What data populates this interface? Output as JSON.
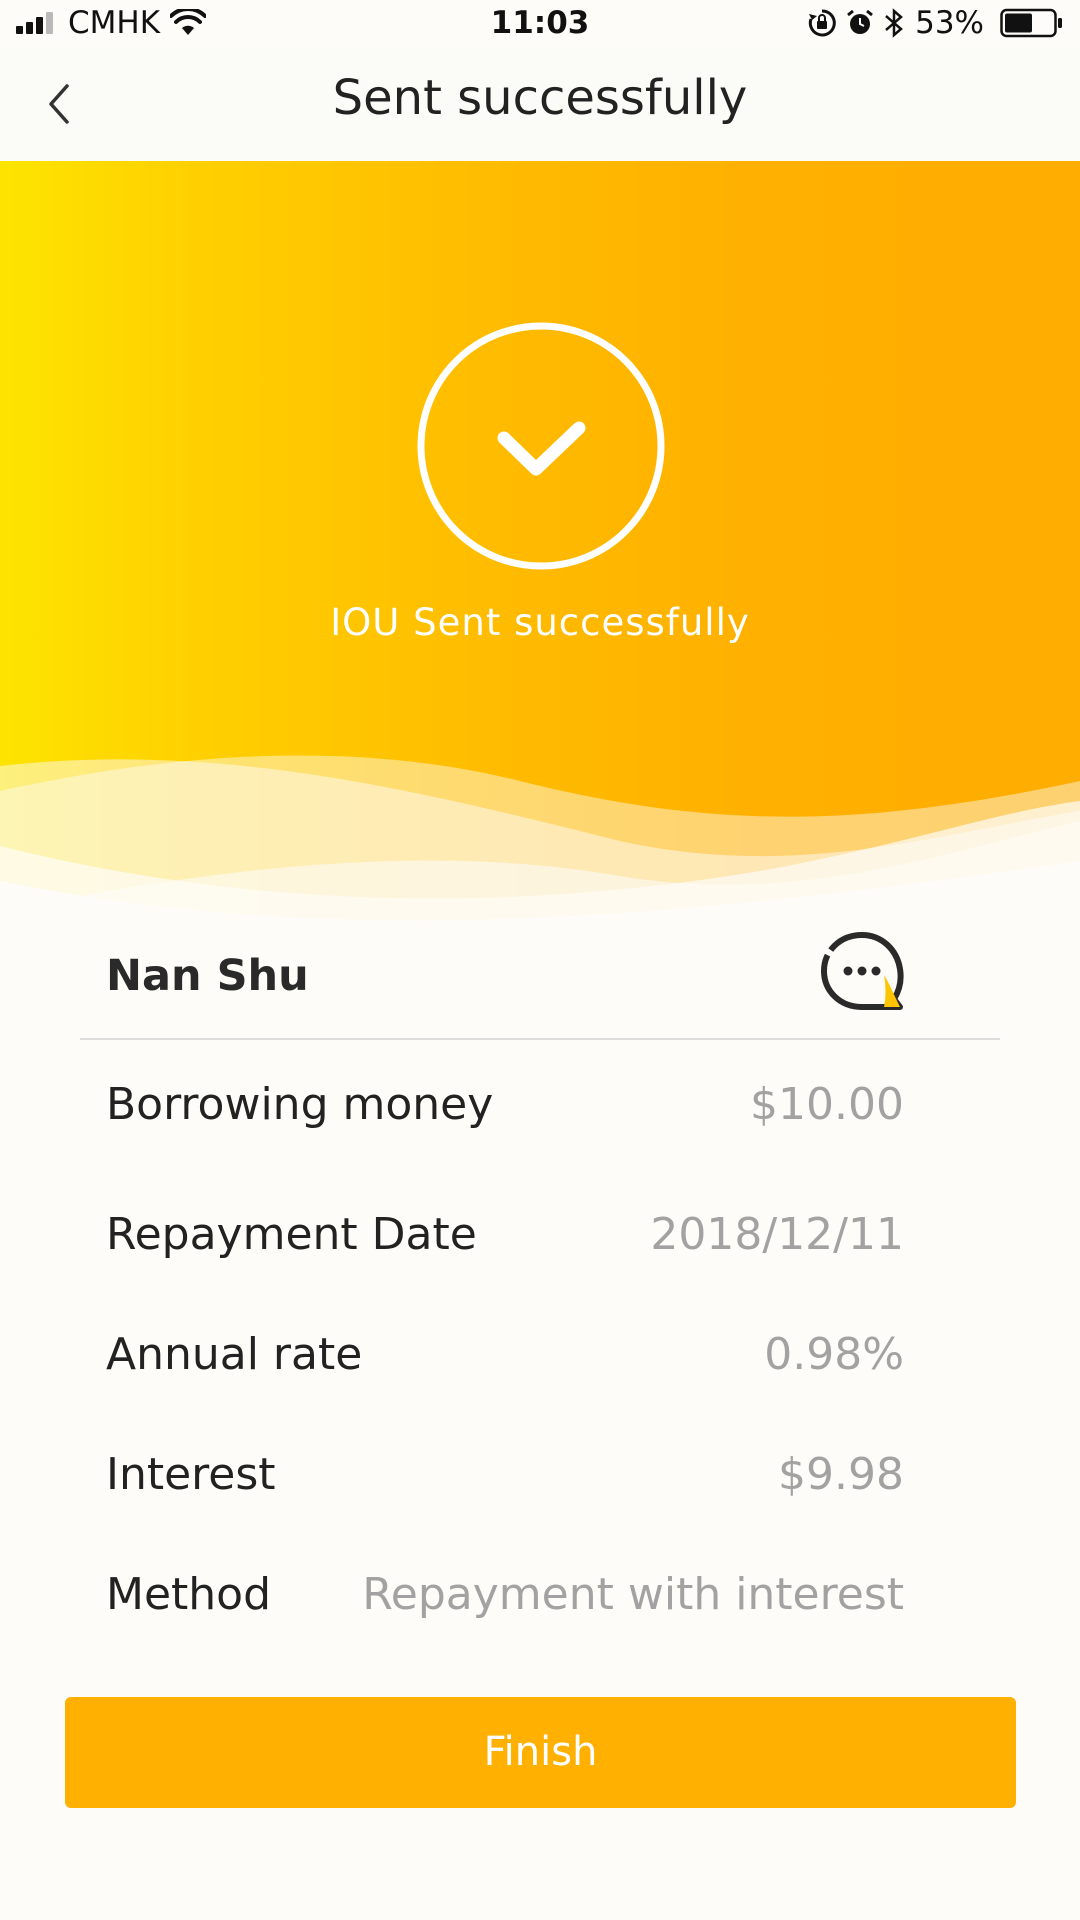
{
  "status_bar": {
    "carrier": "CMHK",
    "time": "11:03",
    "battery": "53%"
  },
  "nav": {
    "title": "Sent successfully"
  },
  "hero": {
    "message": "IOU Sent successfully"
  },
  "details": {
    "name": "Nan Shu",
    "rows": [
      {
        "label": "Borrowing money",
        "value": "$10.00"
      },
      {
        "label": "Repayment Date",
        "value": "2018/12/11"
      },
      {
        "label": "Annual rate",
        "value": "0.98%"
      },
      {
        "label": "Interest",
        "value": "$9.98"
      },
      {
        "label": "Method",
        "value": "Repayment with interest"
      }
    ]
  },
  "actions": {
    "finish_label": "Finish"
  },
  "colors": {
    "accent": "#ffb000",
    "gradient_start": "#fde400",
    "text_primary": "#222222",
    "text_secondary": "#a2a2a2"
  },
  "icons": {
    "back": "chevron-left-icon",
    "success": "check-circle-icon",
    "chat": "chat-bubble-icon"
  }
}
